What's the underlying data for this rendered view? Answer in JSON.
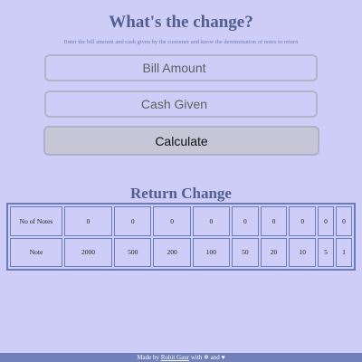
{
  "header": {
    "title": "What's the change?",
    "subtitle": "Enter the bill amount and cash given by the customer and know the denomination of notes to return"
  },
  "form": {
    "bill_placeholder": "Bill Amount",
    "cash_placeholder": "Cash Given",
    "calculate_label": "Calculate"
  },
  "result": {
    "title": "Return Change",
    "rows": [
      {
        "label": "No of Notes",
        "values": [
          "0",
          "0",
          "0",
          "0",
          "0",
          "0",
          "0",
          "0",
          "0"
        ]
      },
      {
        "label": "Note",
        "values": [
          "2000",
          "500",
          "200",
          "100",
          "50",
          "20",
          "10",
          "5",
          "1"
        ]
      }
    ]
  },
  "footer": {
    "prefix": "Made by",
    "author": "Rohit Gaur",
    "with": "with",
    "and": "and",
    "icons": [
      "snowflake-icon",
      "heart-icon"
    ]
  }
}
